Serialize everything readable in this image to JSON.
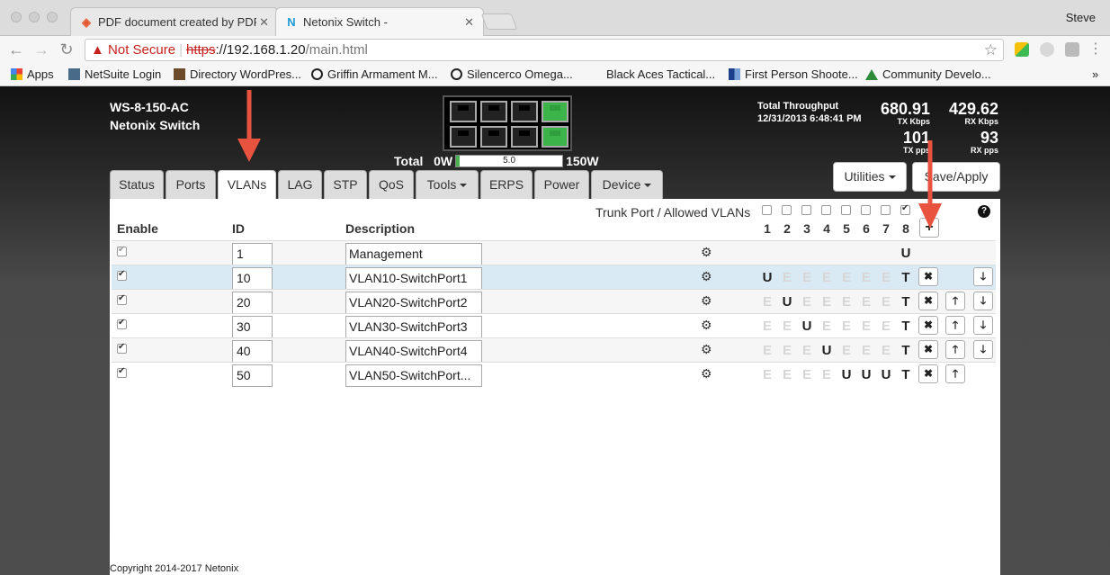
{
  "browser": {
    "tabs": [
      {
        "title": "PDF document created by PDF",
        "icon": "magento-icon"
      },
      {
        "title": "Netonix Switch -",
        "icon": "netonix-icon"
      }
    ],
    "profile": "Steve",
    "address": {
      "warning": "Not Secure",
      "scheme": "https",
      "host": "://192.168.1.20",
      "path": "/main.html"
    },
    "bookmarks": [
      "Apps",
      "NetSuite Login",
      "Directory WordPres...",
      "Griffin Armament M...",
      "Silencerco Omega...",
      "Black Aces Tactical...",
      "First Person Shoote...",
      "Community Develo..."
    ],
    "more": "»"
  },
  "header": {
    "model": "WS-8-150-AC",
    "name": "Netonix Switch",
    "power": {
      "total_label": "Total",
      "min": "0W",
      "value": "5.0",
      "max": "150W",
      "fill_fraction": 0.033
    },
    "throughput": {
      "title": "Total Throughput",
      "date": "12/31/2013 6:48:41 PM",
      "tx_kbps": "680.91",
      "tx_kbps_label": "TX Kbps",
      "rx_kbps": "429.62",
      "rx_kbps_label": "RX Kbps",
      "tx_pps": "101",
      "tx_pps_label": "TX pps",
      "rx_pps": "93",
      "rx_pps_label": "RX pps"
    },
    "utilities": "Utilities",
    "save": "Save/Apply"
  },
  "tabs": [
    {
      "label": "Status"
    },
    {
      "label": "Ports"
    },
    {
      "label": "VLANs",
      "active": true
    },
    {
      "label": "LAG"
    },
    {
      "label": "STP"
    },
    {
      "label": "QoS"
    },
    {
      "label": "Tools",
      "dropdown": true
    },
    {
      "label": "ERPS"
    },
    {
      "label": "Power"
    },
    {
      "label": "Device",
      "dropdown": true
    }
  ],
  "vlan_table": {
    "headers": {
      "enable": "Enable",
      "id": "ID",
      "description": "Description",
      "trunk": "Trunk Port / Allowed VLANs"
    },
    "ports": [
      "1",
      "2",
      "3",
      "4",
      "5",
      "6",
      "7",
      "8"
    ],
    "trunk_checked": [
      false,
      false,
      false,
      false,
      false,
      false,
      false,
      true
    ],
    "add": "+",
    "help": "?",
    "rows": [
      {
        "id": "1",
        "description": "Management",
        "members": [
          "",
          "",
          "",
          "",
          "",
          "",
          "",
          "U"
        ]
      },
      {
        "id": "10",
        "description": "VLAN10-SwitchPort1",
        "members": [
          "U",
          "E",
          "E",
          "E",
          "E",
          "E",
          "E",
          "T"
        ]
      },
      {
        "id": "20",
        "description": "VLAN20-SwitchPort2",
        "members": [
          "E",
          "U",
          "E",
          "E",
          "E",
          "E",
          "E",
          "T"
        ]
      },
      {
        "id": "30",
        "description": "VLAN30-SwitchPort3",
        "members": [
          "E",
          "E",
          "U",
          "E",
          "E",
          "E",
          "E",
          "T"
        ]
      },
      {
        "id": "40",
        "description": "VLAN40-SwitchPort4",
        "members": [
          "E",
          "E",
          "E",
          "U",
          "E",
          "E",
          "E",
          "T"
        ]
      },
      {
        "id": "50",
        "description": "VLAN50-SwitchPort...",
        "members": [
          "E",
          "E",
          "E",
          "E",
          "U",
          "U",
          "U",
          "T"
        ]
      }
    ],
    "remove": "✖",
    "up": "🡑",
    "down": "🡓"
  },
  "footer": {
    "copyright": "Copyright 2014-2017 Netonix"
  },
  "colors": {
    "accent_arrow": "#e8533f",
    "port_active": "#3cb44a",
    "selected_row": "#d9eaf5"
  }
}
